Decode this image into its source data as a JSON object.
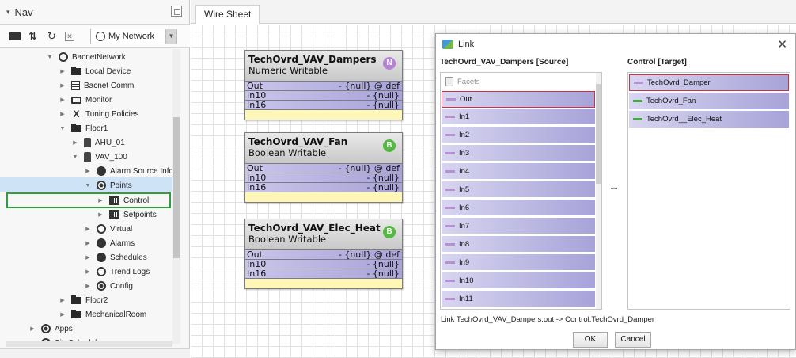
{
  "nav": {
    "title": "Nav",
    "network_selector": "My Network",
    "tree": [
      {
        "label": "BacnetNetwork",
        "icon": "network-icon"
      },
      {
        "label": "Local Device",
        "icon": "device-icon"
      },
      {
        "label": "Bacnet Comm",
        "icon": "server-icon"
      },
      {
        "label": "Monitor",
        "icon": "monitor-icon"
      },
      {
        "label": "Tuning Policies",
        "icon": "tuning-icon"
      },
      {
        "label": "Floor1",
        "icon": "folder-icon"
      },
      {
        "label": "AHU_01",
        "icon": "device-icon"
      },
      {
        "label": "VAV_100",
        "icon": "device-icon"
      },
      {
        "label": "Alarm Source Info",
        "icon": "alarm-icon"
      },
      {
        "label": "Points",
        "icon": "points-icon"
      },
      {
        "label": "Control",
        "icon": "folder-grid-icon"
      },
      {
        "label": "Setpoints",
        "icon": "folder-grid-icon"
      },
      {
        "label": "Virtual",
        "icon": "virtual-icon"
      },
      {
        "label": "Alarms",
        "icon": "alarm-icon"
      },
      {
        "label": "Schedules",
        "icon": "schedule-icon"
      },
      {
        "label": "Trend Logs",
        "icon": "trend-icon"
      },
      {
        "label": "Config",
        "icon": "config-icon"
      },
      {
        "label": "Floor2",
        "icon": "folder-icon"
      },
      {
        "label": "MechanicalRoom",
        "icon": "folder-icon"
      },
      {
        "label": "Apps",
        "icon": "apps-icon"
      },
      {
        "label": "SiteSchedules",
        "icon": "schedule-icon"
      }
    ]
  },
  "wiresheet": {
    "tab": "Wire Sheet",
    "components": [
      {
        "name": "TechOvrd_VAV_Dampers",
        "type": "Numeric Writable",
        "badge": "N",
        "badge_color": "#b384cf",
        "slots": [
          {
            "name": "Out",
            "value": "- {null} @ def"
          },
          {
            "name": "In10",
            "value": "- {null}"
          },
          {
            "name": "In16",
            "value": "- {null}"
          }
        ]
      },
      {
        "name": "TechOvrd_VAV_Fan",
        "type": "Boolean Writable",
        "badge": "B",
        "badge_color": "#54b842",
        "slots": [
          {
            "name": "Out",
            "value": "- {null} @ def"
          },
          {
            "name": "In10",
            "value": "- {null}"
          },
          {
            "name": "In16",
            "value": "- {null}"
          }
        ]
      },
      {
        "name": "TechOvrd_VAV_Elec_Heat",
        "type": "Boolean Writable",
        "badge": "B",
        "badge_color": "#54b842",
        "slots": [
          {
            "name": "Out",
            "value": "- {null} @ def"
          },
          {
            "name": "In10",
            "value": "- {null}"
          },
          {
            "name": "In16",
            "value": "- {null}"
          }
        ]
      }
    ]
  },
  "link_dialog": {
    "title": "Link",
    "source_header": "TechOvrd_VAV_Dampers [Source]",
    "target_header": "Control [Target]",
    "source_items": [
      "Facets",
      "Out",
      "In1",
      "In2",
      "In3",
      "In4",
      "In5",
      "In6",
      "In7",
      "In8",
      "In9",
      "In10",
      "In11"
    ],
    "target_items": [
      {
        "label": "TechOvrd_Damper",
        "color": "#b591d4"
      },
      {
        "label": "TechOvrd_Fan",
        "color": "#45a845"
      },
      {
        "label": "TechOvrd__Elec_Heat",
        "color": "#45a845"
      }
    ],
    "status": "Link TechOvrd_VAV_Dampers.out -> Control.TechOvrd_Damper",
    "ok_label": "OK",
    "cancel_label": "Cancel"
  }
}
